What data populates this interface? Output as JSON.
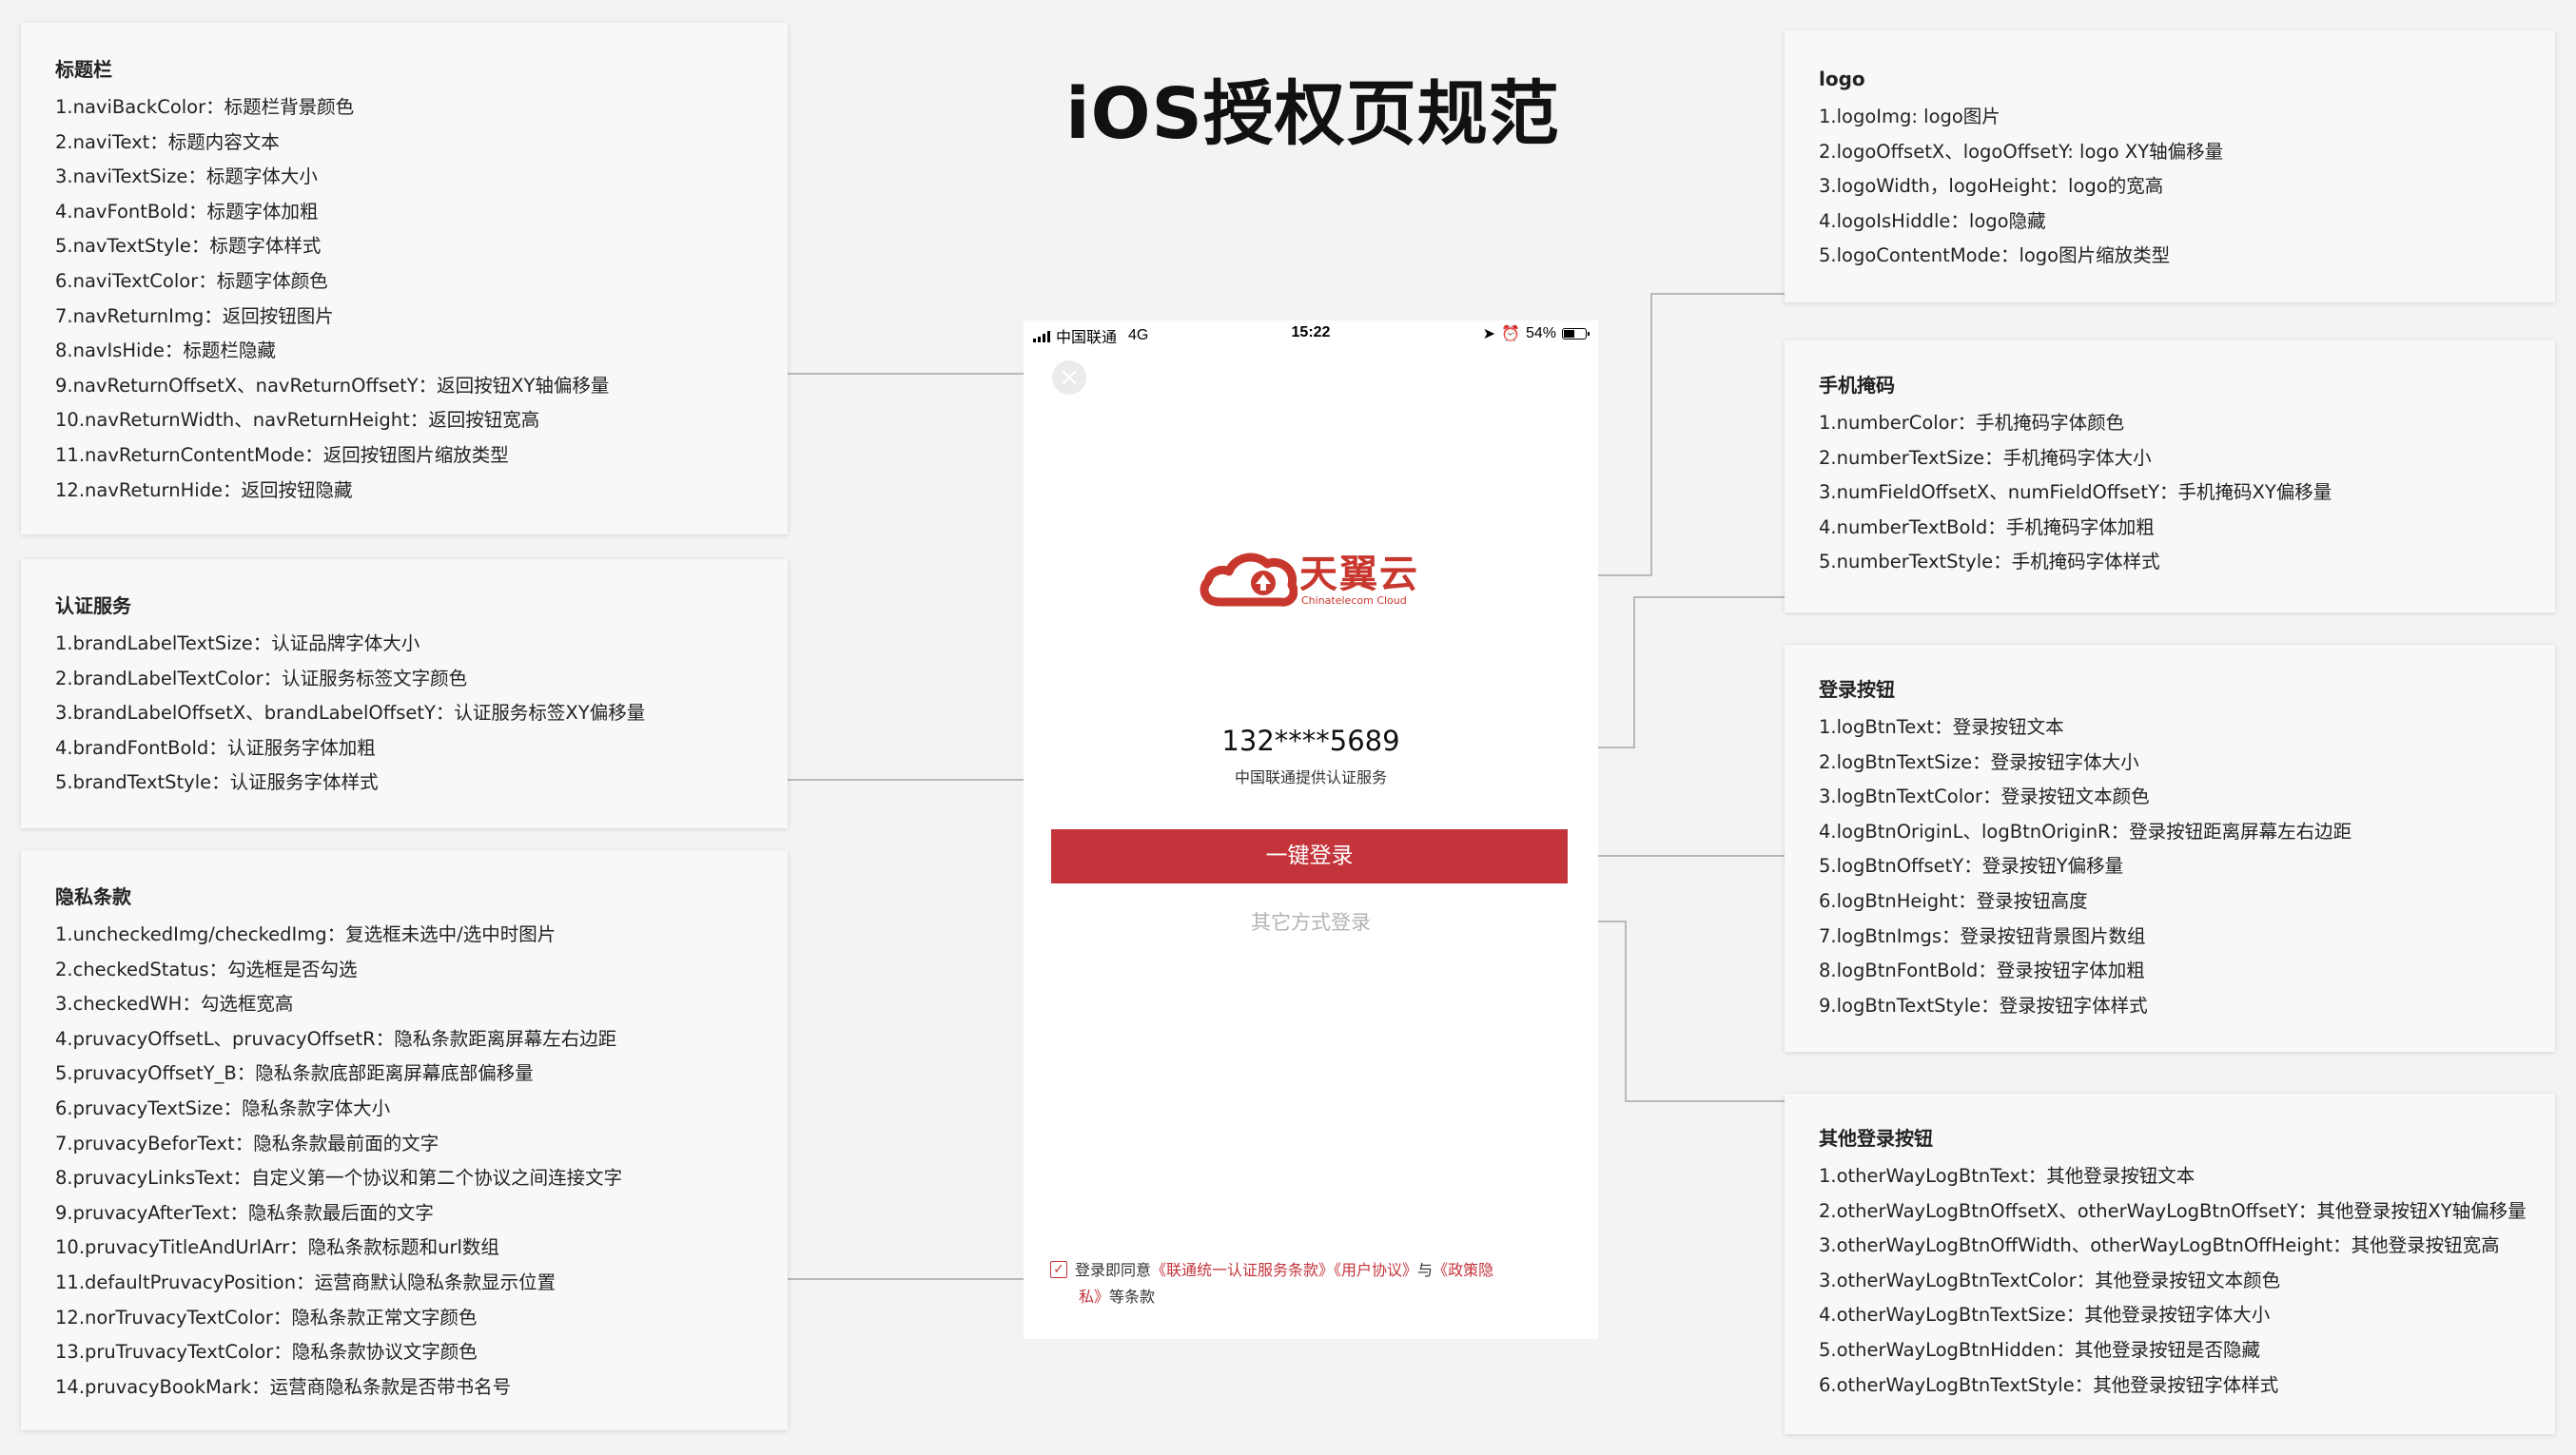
{
  "title": "iOS授权页规范",
  "cards": {
    "nav": {
      "title": "标题栏",
      "items": [
        "1.naviBackColor：标题栏背景颜色",
        "2.naviText：标题内容文本",
        "3.naviTextSize：标题字体大小",
        "4.navFontBold：标题字体加粗",
        "5.navTextStyle：标题字体样式",
        "6.naviTextColor：标题字体颜色",
        "7.navReturnImg：返回按钮图片",
        "8.navIsHide：标题栏隐藏",
        "9.navReturnOffsetX、navReturnOffsetY：返回按钮XY轴偏移量",
        "10.navReturnWidth、navReturnHeight：返回按钮宽高",
        "11.navReturnContentMode：返回按钮图片缩放类型",
        "12.navReturnHide：返回按钮隐藏"
      ]
    },
    "brand": {
      "title": "认证服务",
      "items": [
        "1.brandLabelTextSize：认证品牌字体大小",
        "2.brandLabelTextColor：认证服务标签文字颜色",
        "3.brandLabelOffsetX、brandLabelOffsetY：认证服务标签XY偏移量",
        "4.brandFontBold：认证服务字体加粗",
        "5.brandTextStyle：认证服务字体样式"
      ]
    },
    "privacy": {
      "title": "隐私条款",
      "items": [
        "1.uncheckedImg/checkedImg：复选框未选中/选中时图片",
        "2.checkedStatus：勾选框是否勾选",
        "3.checkedWH：勾选框宽高",
        "4.pruvacyOffsetL、pruvacyOffsetR：隐私条款距离屏幕左右边距",
        "5.pruvacyOffsetY_B：隐私条款底部距离屏幕底部偏移量",
        "6.pruvacyTextSize：隐私条款字体大小",
        "7.pruvacyBeforText：隐私条款最前面的文字",
        "8.pruvacyLinksText：自定义第一个协议和第二个协议之间连接文字",
        "9.pruvacyAfterText：隐私条款最后面的文字",
        "10.pruvacyTitleAndUrlArr：隐私条款标题和url数组",
        "11.defaultPruvacyPosition：运营商默认隐私条款显示位置",
        "12.norTruvacyTextColor：隐私条款正常文字颜色",
        "13.pruTruvacyTextColor：隐私条款协议文字颜色",
        "14.pruvacyBookMark：运营商隐私条款是否带书名号"
      ]
    },
    "logo": {
      "title": "logo",
      "items": [
        "1.logoImg: logo图片",
        "2.logoOffsetX、logoOffsetY: logo XY轴偏移量",
        "3.logoWidth，logoHeight：logo的宽高",
        "4.logoIsHiddle：logo隐藏",
        "5.logoContentMode：logo图片缩放类型"
      ]
    },
    "number": {
      "title": "手机掩码",
      "items": [
        "1.numberColor：手机掩码字体颜色",
        "2.numberTextSize：手机掩码字体大小",
        "3.numFieldOffsetX、numFieldOffsetY：手机掩码XY偏移量",
        "4.numberTextBold：手机掩码字体加粗",
        "5.numberTextStyle：手机掩码字体样式"
      ]
    },
    "loginbtn": {
      "title": "登录按钮",
      "items": [
        "1.logBtnText：登录按钮文本",
        "2.logBtnTextSize：登录按钮字体大小",
        "3.logBtnTextColor：登录按钮文本颜色",
        "4.logBtnOriginL、logBtnOriginR：登录按钮距离屏幕左右边距",
        "5.logBtnOffsetY：登录按钮Y偏移量",
        "6.logBtnHeight：登录按钮高度",
        "7.logBtnImgs：登录按钮背景图片数组",
        "8.logBtnFontBold：登录按钮字体加粗",
        "9.logBtnTextStyle：登录按钮字体样式"
      ]
    },
    "other": {
      "title": "其他登录按钮",
      "items": [
        "1.otherWayLogBtnText：其他登录按钮文本",
        "2.otherWayLogBtnOffsetX、otherWayLogBtnOffsetY：其他登录按钮XY轴偏移量",
        "3.otherWayLogBtnOffWidth、otherWayLogBtnOffHeight：其他登录按钮宽高",
        "3.otherWayLogBtnTextColor：其他登录按钮文本颜色",
        "4.otherWayLogBtnTextSize：其他登录按钮字体大小",
        "5.otherWayLogBtnHidden：其他登录按钮是否隐藏",
        "6.otherWayLogBtnTextStyle：其他登录按钮字体样式"
      ]
    }
  },
  "phone": {
    "status": {
      "carrier": "中国联通",
      "network": "4G",
      "time": "15:22",
      "battery": "54%"
    },
    "close_icon": "close-icon",
    "logo": {
      "cn": "天翼云",
      "en": "Chinatelecom Cloud"
    },
    "number": "132****5689",
    "brand": "中国联通提供认证服务",
    "login_button": "一键登录",
    "other_login": "其它方式登录",
    "privacy": {
      "check": "✓",
      "before": "登录即同意",
      "link1": "《联通统一认证服务条款》",
      "link2": "《用户协议》",
      "connector": "与",
      "link3_a": "《政策隐",
      "link3_b": "私》",
      "after": "等条款"
    }
  },
  "colors": {
    "accent": "#c4343b",
    "background": "#f3f3f3",
    "card": "#f8f8f8",
    "connector": "#b8b8b8"
  }
}
